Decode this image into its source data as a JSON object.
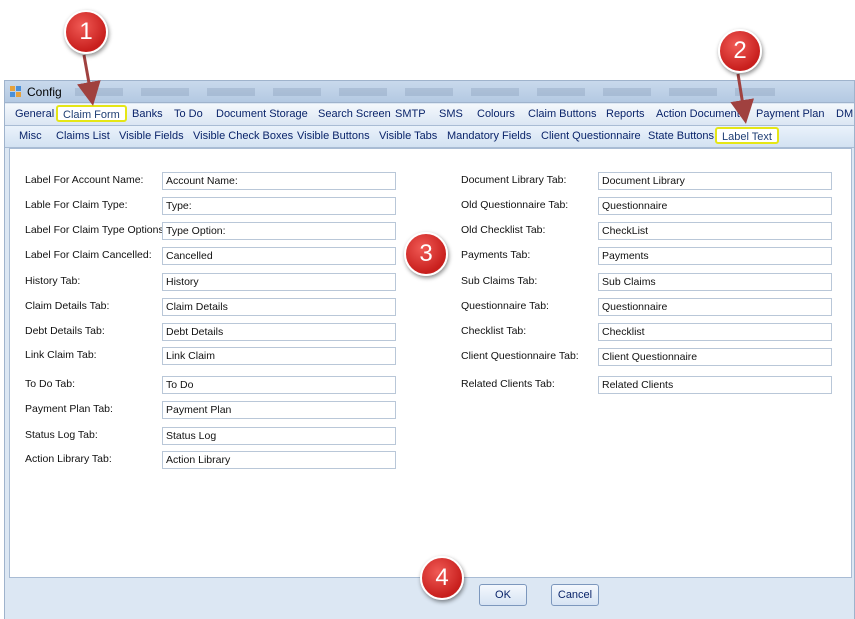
{
  "window": {
    "title": "Config"
  },
  "tabs_main": [
    {
      "label": "General"
    },
    {
      "label": "Claim Form",
      "highlighted": true
    },
    {
      "label": "Banks"
    },
    {
      "label": "To Do"
    },
    {
      "label": "Document Storage"
    },
    {
      "label": "Search Screen"
    },
    {
      "label": "SMTP"
    },
    {
      "label": "SMS"
    },
    {
      "label": "Colours"
    },
    {
      "label": "Claim Buttons"
    },
    {
      "label": "Reports"
    },
    {
      "label": "Action Documents"
    },
    {
      "label": "Payment Plan"
    },
    {
      "label": "DM"
    }
  ],
  "tabs_sub": [
    {
      "label": "Misc"
    },
    {
      "label": "Claims List"
    },
    {
      "label": "Visible Fields"
    },
    {
      "label": "Visible Check Boxes"
    },
    {
      "label": "Visible Buttons"
    },
    {
      "label": "Visible Tabs"
    },
    {
      "label": "Mandatory Fields"
    },
    {
      "label": "Client Questionnaire"
    },
    {
      "label": "State Buttons"
    },
    {
      "label": "Label Text",
      "highlighted": true,
      "selected": true
    }
  ],
  "left_fields": [
    {
      "label": "Label For Account Name:",
      "value": "Account Name:"
    },
    {
      "label": "Lable For Claim Type:",
      "value": "Type:"
    },
    {
      "label": "Label For Claim Type Options:",
      "value": "Type Option:"
    },
    {
      "label": "Label For Claim Cancelled:",
      "value": "Cancelled"
    },
    {
      "label": "History Tab:",
      "value": "History"
    },
    {
      "label": "Claim Details Tab:",
      "value": "Claim Details"
    },
    {
      "label": "Debt Details Tab:",
      "value": "Debt Details"
    },
    {
      "label": "Link Claim Tab:",
      "value": "Link Claim"
    },
    {
      "label": "To Do Tab:",
      "value": "To Do"
    },
    {
      "label": "Payment Plan Tab:",
      "value": "Payment Plan"
    },
    {
      "label": "Status Log Tab:",
      "value": "Status Log"
    },
    {
      "label": "Action Library Tab:",
      "value": "Action Library"
    }
  ],
  "right_fields": [
    {
      "label": "Document Library Tab:",
      "value": "Document Library"
    },
    {
      "label": "Old Questionnaire Tab:",
      "value": "Questionnaire"
    },
    {
      "label": "Old Checklist Tab:",
      "value": "CheckList"
    },
    {
      "label": "Payments Tab:",
      "value": "Payments"
    },
    {
      "label": "Sub Claims Tab:",
      "value": "Sub Claims"
    },
    {
      "label": "Questionnaire Tab:",
      "value": "Questionnaire"
    },
    {
      "label": "Checklist Tab:",
      "value": "Checklist"
    },
    {
      "label": "Client Questionnaire Tab:",
      "value": "Client Questionnaire"
    },
    {
      "label": "Related Clients Tab:",
      "value": "Related Clients"
    }
  ],
  "buttons": {
    "ok": "OK",
    "cancel": "Cancel"
  },
  "callouts": {
    "one": "1",
    "two": "2",
    "three": "3",
    "four": "4"
  },
  "colors": {
    "callout": "#d8282a",
    "highlight": "#e5e616",
    "window_bg": "#dce7f3",
    "tab_text": "#0a246a"
  },
  "icons": {
    "app": "config-app-icon"
  }
}
